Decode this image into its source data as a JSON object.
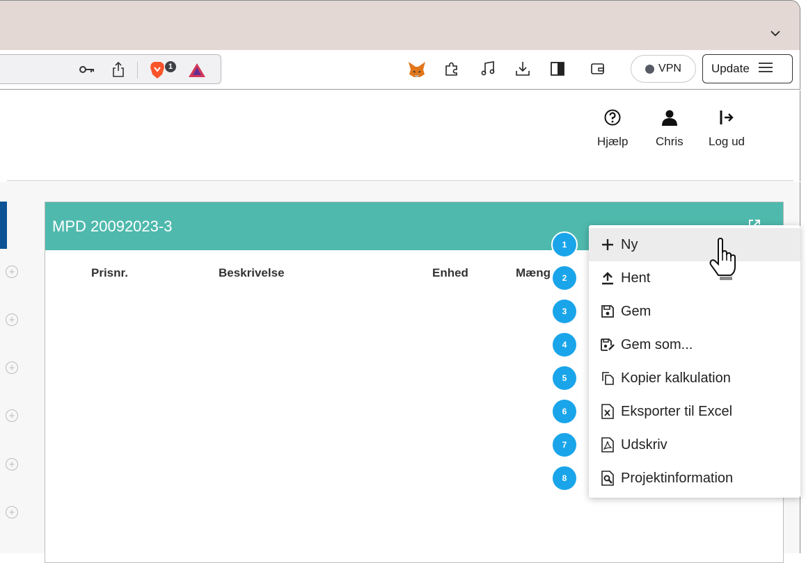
{
  "browser": {
    "vpn_label": "VPN",
    "update_label": "Update",
    "brave_badge_count": "1"
  },
  "header": {
    "help_label": "Hjælp",
    "user_label": "Chris",
    "logout_label": "Log ud"
  },
  "panel": {
    "title": "MPD 20092023-3",
    "columns": [
      "Prisnr.",
      "Beskrivelse",
      "Enhed",
      "Mæng"
    ]
  },
  "menu": {
    "items": [
      {
        "badge": "1",
        "label": "Ny",
        "icon": "plus-icon"
      },
      {
        "badge": "2",
        "label": "Hent",
        "icon": "upload-icon"
      },
      {
        "badge": "3",
        "label": "Gem",
        "icon": "save-icon"
      },
      {
        "badge": "4",
        "label": "Gem som...",
        "icon": "save-as-icon"
      },
      {
        "badge": "5",
        "label": "Kopier kalkulation",
        "icon": "copy-icon"
      },
      {
        "badge": "6",
        "label": "Eksporter til Excel",
        "icon": "excel-icon"
      },
      {
        "badge": "7",
        "label": "Udskriv",
        "icon": "pdf-icon"
      },
      {
        "badge": "8",
        "label": "Projektinformation",
        "icon": "project-info-icon"
      }
    ]
  },
  "colors": {
    "panel_header": "#4fb9ad",
    "badge": "#1aa5ea",
    "left_strip": "#0b5394"
  }
}
